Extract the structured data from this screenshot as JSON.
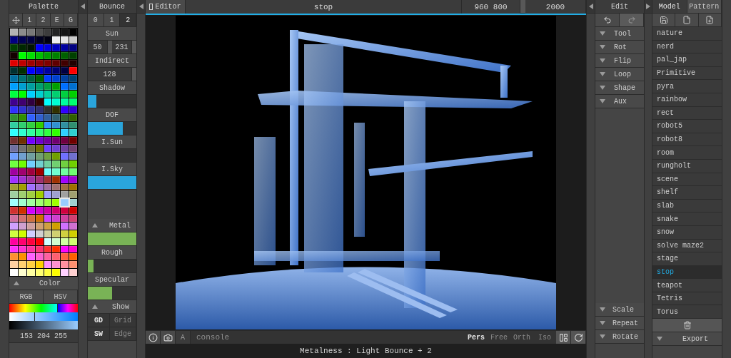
{
  "palette": {
    "title": "Palette",
    "tabs": [
      {
        "kind": "move",
        "selected": false
      },
      {
        "label": "1",
        "selected": false
      },
      {
        "label": "2",
        "selected": false
      },
      {
        "label": "E",
        "selected": false
      },
      {
        "label": "G",
        "selected": false
      }
    ],
    "swatches": [
      {
        "color": "#b4b4b4",
        "selected": false
      },
      {
        "color": "#8c8c8c",
        "selected": false
      },
      {
        "color": "#787878",
        "selected": false
      },
      {
        "color": "#505050",
        "selected": false
      },
      {
        "color": "#3c3c3c",
        "selected": false
      },
      {
        "color": "#232323",
        "selected": false
      },
      {
        "color": "#141414",
        "selected": false
      },
      {
        "color": "#000000",
        "selected": false
      },
      {
        "color": "#000080",
        "selected": false
      },
      {
        "color": "#000050",
        "selected": false
      },
      {
        "color": "#000040",
        "selected": false
      },
      {
        "color": "#000020",
        "selected": false
      },
      {
        "color": "#000010",
        "selected": false
      },
      {
        "color": "#f0f0f0",
        "selected": false
      },
      {
        "color": "#e6e6e6",
        "selected": false
      },
      {
        "color": "#c8c8c8",
        "selected": false
      },
      {
        "color": "#004000",
        "selected": false
      },
      {
        "color": "#002800",
        "selected": false
      },
      {
        "color": "#001400",
        "selected": false
      },
      {
        "color": "#0000ff",
        "selected": false
      },
      {
        "color": "#0000e0",
        "selected": false
      },
      {
        "color": "#0000c0",
        "selected": false
      },
      {
        "color": "#0000a0",
        "selected": false
      },
      {
        "color": "#000080",
        "selected": false
      },
      {
        "color": "#140000",
        "selected": false
      },
      {
        "color": "#00ff00",
        "selected": false
      },
      {
        "color": "#00e000",
        "selected": false
      },
      {
        "color": "#00c000",
        "selected": false
      },
      {
        "color": "#00a000",
        "selected": false
      },
      {
        "color": "#008000",
        "selected": false
      },
      {
        "color": "#006000",
        "selected": false
      },
      {
        "color": "#004000",
        "selected": false
      },
      {
        "color": "#e00000",
        "selected": false
      },
      {
        "color": "#c00000",
        "selected": false
      },
      {
        "color": "#a00000",
        "selected": false
      },
      {
        "color": "#900000",
        "selected": false
      },
      {
        "color": "#800000",
        "selected": false
      },
      {
        "color": "#600000",
        "selected": false
      },
      {
        "color": "#400000",
        "selected": false
      },
      {
        "color": "#200000",
        "selected": false
      },
      {
        "color": "#003030",
        "selected": false
      },
      {
        "color": "#003000",
        "selected": false
      },
      {
        "color": "#0000ff",
        "selected": false
      },
      {
        "color": "#0000d0",
        "selected": false
      },
      {
        "color": "#0000a0",
        "selected": false
      },
      {
        "color": "#000070",
        "selected": false
      },
      {
        "color": "#000040",
        "selected": false
      },
      {
        "color": "#ff0000",
        "selected": false
      },
      {
        "color": "#0070a0",
        "selected": false
      },
      {
        "color": "#007070",
        "selected": false
      },
      {
        "color": "#006040",
        "selected": false
      },
      {
        "color": "#006000",
        "selected": false
      },
      {
        "color": "#0040ff",
        "selected": false
      },
      {
        "color": "#0040d0",
        "selected": false
      },
      {
        "color": "#0040a0",
        "selected": false
      },
      {
        "color": "#004070",
        "selected": false
      },
      {
        "color": "#00a0ff",
        "selected": false
      },
      {
        "color": "#00a0d0",
        "selected": false
      },
      {
        "color": "#00a0a0",
        "selected": false
      },
      {
        "color": "#00a070",
        "selected": false
      },
      {
        "color": "#00a040",
        "selected": false
      },
      {
        "color": "#00a000",
        "selected": false
      },
      {
        "color": "#0070ff",
        "selected": false
      },
      {
        "color": "#0070d0",
        "selected": false
      },
      {
        "color": "#00ff40",
        "selected": false
      },
      {
        "color": "#00ff00",
        "selected": false
      },
      {
        "color": "#00d0ff",
        "selected": false
      },
      {
        "color": "#00d0d0",
        "selected": false
      },
      {
        "color": "#00d0a0",
        "selected": false
      },
      {
        "color": "#00d070",
        "selected": false
      },
      {
        "color": "#00d040",
        "selected": false
      },
      {
        "color": "#00d000",
        "selected": false
      },
      {
        "color": "#400090",
        "selected": false
      },
      {
        "color": "#400070",
        "selected": false
      },
      {
        "color": "#300040",
        "selected": false
      },
      {
        "color": "#300000",
        "selected": false
      },
      {
        "color": "#00ffff",
        "selected": false
      },
      {
        "color": "#00ffd0",
        "selected": false
      },
      {
        "color": "#00ffa0",
        "selected": false
      },
      {
        "color": "#00ff70",
        "selected": false
      },
      {
        "color": "#3030ff",
        "selected": false
      },
      {
        "color": "#3030d0",
        "selected": false
      },
      {
        "color": "#3030a0",
        "selected": false
      },
      {
        "color": "#303070",
        "selected": false
      },
      {
        "color": "#303030",
        "selected": false
      },
      {
        "color": "#303000",
        "selected": false
      },
      {
        "color": "#3000ff",
        "selected": false
      },
      {
        "color": "#3000d0",
        "selected": false
      },
      {
        "color": "#309030",
        "selected": false
      },
      {
        "color": "#309000",
        "selected": false
      },
      {
        "color": "#3060ff",
        "selected": false
      },
      {
        "color": "#3060d0",
        "selected": false
      },
      {
        "color": "#3060a0",
        "selected": false
      },
      {
        "color": "#306070",
        "selected": false
      },
      {
        "color": "#306030",
        "selected": false
      },
      {
        "color": "#306000",
        "selected": false
      },
      {
        "color": "#30d0a0",
        "selected": false
      },
      {
        "color": "#30d070",
        "selected": false
      },
      {
        "color": "#30d040",
        "selected": false
      },
      {
        "color": "#30d000",
        "selected": false
      },
      {
        "color": "#3090ff",
        "selected": false
      },
      {
        "color": "#3090d0",
        "selected": false
      },
      {
        "color": "#3090a0",
        "selected": false
      },
      {
        "color": "#309070",
        "selected": false
      },
      {
        "color": "#30ffff",
        "selected": false
      },
      {
        "color": "#30ffd0",
        "selected": false
      },
      {
        "color": "#30ffa0",
        "selected": false
      },
      {
        "color": "#30ff70",
        "selected": false
      },
      {
        "color": "#30ff40",
        "selected": false
      },
      {
        "color": "#30ff00",
        "selected": false
      },
      {
        "color": "#30d0ff",
        "selected": false
      },
      {
        "color": "#30d0d0",
        "selected": false
      },
      {
        "color": "#703030",
        "selected": false
      },
      {
        "color": "#703000",
        "selected": false
      },
      {
        "color": "#7000ff",
        "selected": false
      },
      {
        "color": "#7000d0",
        "selected": false
      },
      {
        "color": "#7000a0",
        "selected": false
      },
      {
        "color": "#700070",
        "selected": false
      },
      {
        "color": "#700040",
        "selected": false
      },
      {
        "color": "#700000",
        "selected": false
      },
      {
        "color": "#7070a0",
        "selected": false
      },
      {
        "color": "#707070",
        "selected": false
      },
      {
        "color": "#707040",
        "selected": false
      },
      {
        "color": "#707000",
        "selected": false
      },
      {
        "color": "#7040ff",
        "selected": false
      },
      {
        "color": "#7040d0",
        "selected": false
      },
      {
        "color": "#7040a0",
        "selected": false
      },
      {
        "color": "#704070",
        "selected": false
      },
      {
        "color": "#70a0ff",
        "selected": false
      },
      {
        "color": "#70a0d0",
        "selected": false
      },
      {
        "color": "#70a0a0",
        "selected": false
      },
      {
        "color": "#70a070",
        "selected": false
      },
      {
        "color": "#70a040",
        "selected": false
      },
      {
        "color": "#70a000",
        "selected": false
      },
      {
        "color": "#7070ff",
        "selected": false
      },
      {
        "color": "#7070d0",
        "selected": false
      },
      {
        "color": "#70ff40",
        "selected": false
      },
      {
        "color": "#70ff00",
        "selected": false
      },
      {
        "color": "#70d0ff",
        "selected": false
      },
      {
        "color": "#70d0d0",
        "selected": false
      },
      {
        "color": "#70d0a0",
        "selected": false
      },
      {
        "color": "#70d070",
        "selected": false
      },
      {
        "color": "#70d040",
        "selected": false
      },
      {
        "color": "#70d000",
        "selected": false
      },
      {
        "color": "#a000a0",
        "selected": false
      },
      {
        "color": "#a00070",
        "selected": false
      },
      {
        "color": "#a00040",
        "selected": false
      },
      {
        "color": "#a00000",
        "selected": false
      },
      {
        "color": "#70ffff",
        "selected": false
      },
      {
        "color": "#70ffd0",
        "selected": false
      },
      {
        "color": "#70ffa0",
        "selected": false
      },
      {
        "color": "#70ff70",
        "selected": false
      },
      {
        "color": "#a030ff",
        "selected": false
      },
      {
        "color": "#a030d0",
        "selected": false
      },
      {
        "color": "#a030a0",
        "selected": false
      },
      {
        "color": "#a03070",
        "selected": false
      },
      {
        "color": "#a03030",
        "selected": false
      },
      {
        "color": "#a03000",
        "selected": false
      },
      {
        "color": "#a000ff",
        "selected": false
      },
      {
        "color": "#a000d0",
        "selected": false
      },
      {
        "color": "#a0a030",
        "selected": false
      },
      {
        "color": "#a0a000",
        "selected": false
      },
      {
        "color": "#a070ff",
        "selected": false
      },
      {
        "color": "#a070d0",
        "selected": false
      },
      {
        "color": "#a070a0",
        "selected": false
      },
      {
        "color": "#a07070",
        "selected": false
      },
      {
        "color": "#a07040",
        "selected": false
      },
      {
        "color": "#a07000",
        "selected": false
      },
      {
        "color": "#a0d0a0",
        "selected": false
      },
      {
        "color": "#a0d070",
        "selected": false
      },
      {
        "color": "#a0d040",
        "selected": false
      },
      {
        "color": "#a0d000",
        "selected": false
      },
      {
        "color": "#a0a0ff",
        "selected": false
      },
      {
        "color": "#a0a0d0",
        "selected": false
      },
      {
        "color": "#a0a0a0",
        "selected": false
      },
      {
        "color": "#a0a070",
        "selected": false
      },
      {
        "color": "#a0ffff",
        "selected": false
      },
      {
        "color": "#a0ffd0",
        "selected": false
      },
      {
        "color": "#a0ffa0",
        "selected": false
      },
      {
        "color": "#a0ff70",
        "selected": false
      },
      {
        "color": "#a0ff40",
        "selected": false
      },
      {
        "color": "#a0ff00",
        "selected": false
      },
      {
        "color": "#99ccff",
        "selected": true
      },
      {
        "color": "#a0d0d0",
        "selected": false
      },
      {
        "color": "#d03030",
        "selected": false
      },
      {
        "color": "#d03000",
        "selected": false
      },
      {
        "color": "#d000ff",
        "selected": false
      },
      {
        "color": "#d000d0",
        "selected": false
      },
      {
        "color": "#d000a0",
        "selected": false
      },
      {
        "color": "#d00070",
        "selected": false
      },
      {
        "color": "#d00040",
        "selected": false
      },
      {
        "color": "#d00000",
        "selected": false
      },
      {
        "color": "#d070a0",
        "selected": false
      },
      {
        "color": "#d07070",
        "selected": false
      },
      {
        "color": "#d07040",
        "selected": false
      },
      {
        "color": "#d07000",
        "selected": false
      },
      {
        "color": "#d040ff",
        "selected": false
      },
      {
        "color": "#d040d0",
        "selected": false
      },
      {
        "color": "#d040a0",
        "selected": false
      },
      {
        "color": "#d04070",
        "selected": false
      },
      {
        "color": "#d0a0ff",
        "selected": false
      },
      {
        "color": "#d0a0d0",
        "selected": false
      },
      {
        "color": "#d0a0a0",
        "selected": false
      },
      {
        "color": "#d0a070",
        "selected": false
      },
      {
        "color": "#d0a040",
        "selected": false
      },
      {
        "color": "#d0a000",
        "selected": false
      },
      {
        "color": "#d070ff",
        "selected": false
      },
      {
        "color": "#d070d0",
        "selected": false
      },
      {
        "color": "#d0ff40",
        "selected": false
      },
      {
        "color": "#d0ff00",
        "selected": false
      },
      {
        "color": "#d0d0ff",
        "selected": false
      },
      {
        "color": "#d0d0d0",
        "selected": false
      },
      {
        "color": "#d0d0a0",
        "selected": false
      },
      {
        "color": "#d0d070",
        "selected": false
      },
      {
        "color": "#d0d040",
        "selected": false
      },
      {
        "color": "#d0d000",
        "selected": false
      },
      {
        "color": "#ff00a0",
        "selected": false
      },
      {
        "color": "#ff0070",
        "selected": false
      },
      {
        "color": "#ff0040",
        "selected": false
      },
      {
        "color": "#ff0000",
        "selected": false
      },
      {
        "color": "#d0ffff",
        "selected": false
      },
      {
        "color": "#d0ffd0",
        "selected": false
      },
      {
        "color": "#d0ffa0",
        "selected": false
      },
      {
        "color": "#d0ff70",
        "selected": false
      },
      {
        "color": "#ff30ff",
        "selected": false
      },
      {
        "color": "#ff30d0",
        "selected": false
      },
      {
        "color": "#ff30a0",
        "selected": false
      },
      {
        "color": "#ff3070",
        "selected": false
      },
      {
        "color": "#ff3030",
        "selected": false
      },
      {
        "color": "#ff3000",
        "selected": false
      },
      {
        "color": "#ff00ff",
        "selected": false
      },
      {
        "color": "#ff00d0",
        "selected": false
      },
      {
        "color": "#ff9030",
        "selected": false
      },
      {
        "color": "#ff9000",
        "selected": false
      },
      {
        "color": "#ff60ff",
        "selected": false
      },
      {
        "color": "#ff60d0",
        "selected": false
      },
      {
        "color": "#ff60a0",
        "selected": false
      },
      {
        "color": "#ff6070",
        "selected": false
      },
      {
        "color": "#ff6040",
        "selected": false
      },
      {
        "color": "#ff6000",
        "selected": false
      },
      {
        "color": "#ffd0a0",
        "selected": false
      },
      {
        "color": "#ffd070",
        "selected": false
      },
      {
        "color": "#ffd040",
        "selected": false
      },
      {
        "color": "#ffd000",
        "selected": false
      },
      {
        "color": "#ff90ff",
        "selected": false
      },
      {
        "color": "#ff90d0",
        "selected": false
      },
      {
        "color": "#ff90a0",
        "selected": false
      },
      {
        "color": "#ff9070",
        "selected": false
      },
      {
        "color": "#ffffff",
        "selected": false
      },
      {
        "color": "#ffffd0",
        "selected": false
      },
      {
        "color": "#ffffa0",
        "selected": false
      },
      {
        "color": "#ffff70",
        "selected": false
      },
      {
        "color": "#ffff40",
        "selected": false
      },
      {
        "color": "#ffff00",
        "selected": false
      },
      {
        "color": "#ffd0ff",
        "selected": false
      },
      {
        "color": "#ffd0d0",
        "selected": false
      }
    ],
    "color_section": {
      "label": "Color",
      "expanded": true
    },
    "modes": [
      {
        "label": "RGB",
        "selected": false
      },
      {
        "label": "HSV",
        "selected": false
      }
    ],
    "rgb": "153 204 255"
  },
  "bounce": {
    "title": "Bounce",
    "tabs": [
      {
        "label": "0",
        "selected": false
      },
      {
        "label": "1",
        "selected": false
      },
      {
        "label": "2",
        "selected": true
      }
    ],
    "sun": {
      "label": "Sun",
      "values": [
        "50",
        "231"
      ]
    },
    "indirect": {
      "label": "Indirect",
      "value": "128"
    },
    "light_sliders": [
      {
        "label": "Shadow",
        "level": 0.17
      },
      {
        "label": "DOF",
        "level": 0.72
      },
      {
        "label": "I.Sun",
        "level": 0
      },
      {
        "label": "I.Sky",
        "level": 1
      }
    ],
    "material": {
      "expanded": true,
      "sliders": [
        {
          "label": "Metal",
          "level": 1
        },
        {
          "label": "Rough",
          "level": 0.12
        },
        {
          "label": "Specular",
          "level": 0.5
        }
      ]
    },
    "show": {
      "label": "Show",
      "expanded": true,
      "toggles": [
        {
          "label": "GD",
          "on": true
        },
        {
          "label": "Grid",
          "on": false
        },
        {
          "label": "SW",
          "on": true
        },
        {
          "label": "Edge",
          "on": false
        }
      ]
    }
  },
  "viewport": {
    "mode_button": "Editor",
    "title": "stop",
    "size": "960 800",
    "samples": "2000",
    "text_button": "A",
    "console_placeholder": "console",
    "projections": [
      {
        "label": "Pers",
        "selected": true
      },
      {
        "label": "Free",
        "selected": false
      },
      {
        "label": "Orth",
        "selected": false
      },
      {
        "label": "Iso",
        "selected": false
      }
    ],
    "status": "Metalness : Light Bounce + 2"
  },
  "edit": {
    "title": "Edit",
    "redo_disabled": true,
    "tools": [
      {
        "label": "Tool",
        "expanded": false
      },
      {
        "label": "Rot",
        "expanded": false
      },
      {
        "label": "Flip",
        "expanded": false
      },
      {
        "label": "Loop",
        "expanded": false
      },
      {
        "label": "Shape",
        "expanded": false
      },
      {
        "label": "Aux",
        "expanded": false
      }
    ],
    "bottom_tools": [
      {
        "label": "Scale",
        "expanded": false
      },
      {
        "label": "Repeat",
        "expanded": false
      },
      {
        "label": "Rotate",
        "expanded": false
      }
    ]
  },
  "files": {
    "tabs": [
      {
        "label": "Model",
        "selected": true
      },
      {
        "label": "Pattern",
        "selected": false
      }
    ],
    "items": [
      {
        "label": "nature",
        "selected": false
      },
      {
        "label": "nerd",
        "selected": false
      },
      {
        "label": "pal_jap",
        "selected": false
      },
      {
        "label": "Primitive",
        "selected": false
      },
      {
        "label": "pyra",
        "selected": false
      },
      {
        "label": "rainbow",
        "selected": false
      },
      {
        "label": "rect",
        "selected": false
      },
      {
        "label": "robot5",
        "selected": false
      },
      {
        "label": "robot8",
        "selected": false
      },
      {
        "label": "room",
        "selected": false
      },
      {
        "label": "rungholt",
        "selected": false
      },
      {
        "label": "scene",
        "selected": false
      },
      {
        "label": "shelf",
        "selected": false
      },
      {
        "label": "slab",
        "selected": false
      },
      {
        "label": "snake",
        "selected": false
      },
      {
        "label": "snow",
        "selected": false
      },
      {
        "label": "solve maze2",
        "selected": false
      },
      {
        "label": "stage",
        "selected": false
      },
      {
        "label": "stop",
        "selected": true
      },
      {
        "label": "teapot",
        "selected": false
      },
      {
        "label": "Tetris",
        "selected": false
      },
      {
        "label": "Torus",
        "selected": false
      }
    ],
    "export": {
      "label": "Export",
      "expanded": false
    }
  }
}
